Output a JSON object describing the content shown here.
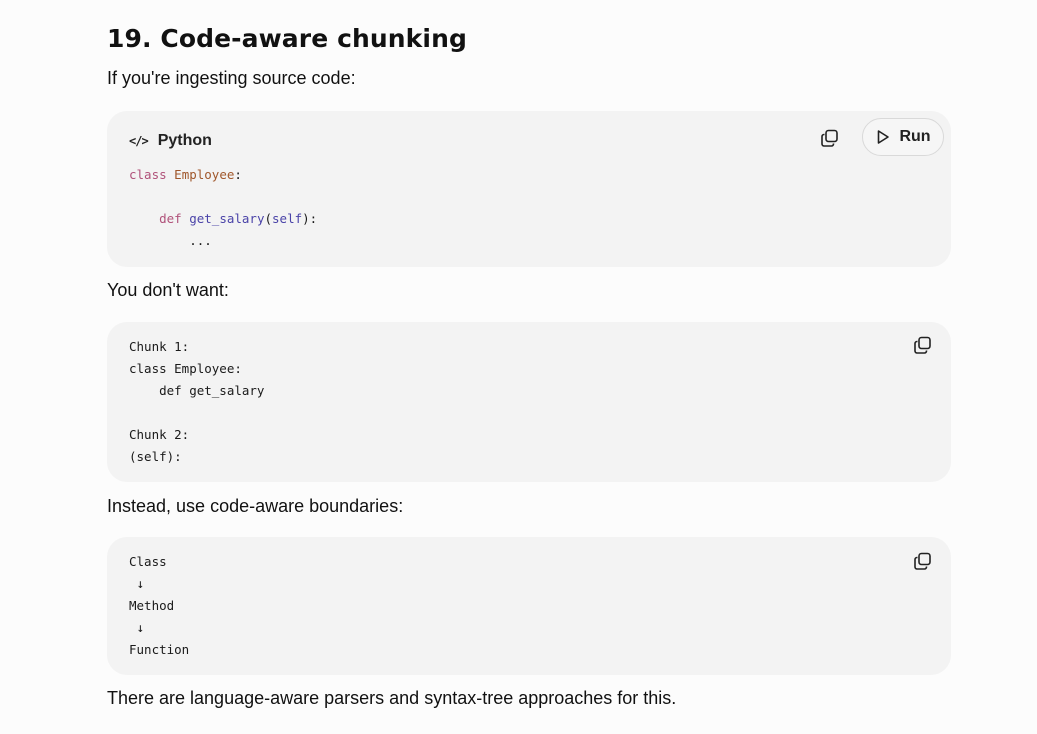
{
  "section": {
    "heading": "19. Code-aware chunking",
    "intro": "If you're ingesting source code:",
    "dont_want": "You don't want:",
    "instead": "Instead, use code-aware boundaries:",
    "outro": "There are language-aware parsers and syntax-tree approaches for this."
  },
  "code_block_1": {
    "language": "Python",
    "run_label": "Run",
    "lines": {
      "l1_kw": "class",
      "l1_cls": "Employee",
      "l1_tail": ":",
      "l3_kw": "def",
      "l3_fn": "get_salary",
      "l3_open": "(",
      "l3_self": "self",
      "l3_close": "):",
      "l4": "..."
    }
  },
  "code_block_2": {
    "text": "Chunk 1:\nclass Employee:\n    def get_salary\n\nChunk 2:\n(self):"
  },
  "code_block_3": {
    "text": "Class\n ↓\nMethod\n ↓\nFunction"
  },
  "icons": {
    "lang": "code-icon",
    "copy": "copy-icon",
    "run": "play-icon"
  }
}
